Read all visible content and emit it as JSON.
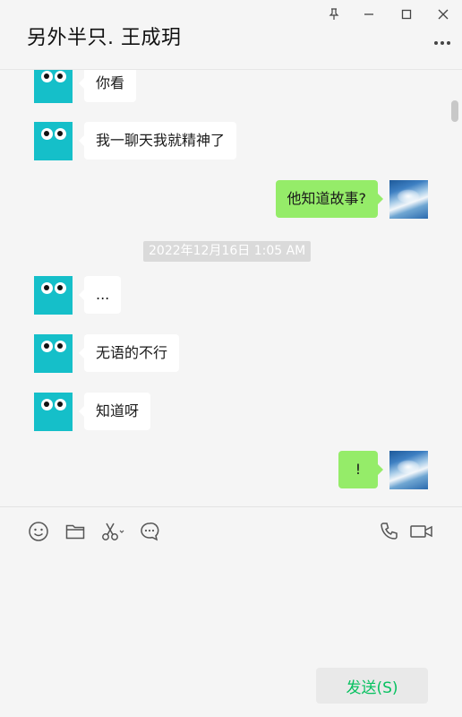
{
  "window": {
    "title": "另外半只. 王成玥",
    "buttons": [
      "pin-icon",
      "minimize-icon",
      "maximize-icon",
      "close-icon"
    ]
  },
  "messages": [
    {
      "side": "in",
      "text": "你看"
    },
    {
      "side": "in",
      "text": "我一聊天我就精神了"
    },
    {
      "side": "out",
      "text": "他知道故事?"
    },
    {
      "side": "in",
      "text": "..."
    },
    {
      "side": "in",
      "text": "无语的不行"
    },
    {
      "side": "in",
      "text": "知道呀"
    },
    {
      "side": "out",
      "text": "!"
    }
  ],
  "timestamp": "2022年12月16日 1:05 AM",
  "toolbar": {
    "left": [
      "emoji-icon",
      "folder-icon",
      "scissors-icon",
      "chat-history-icon"
    ],
    "right": [
      "phone-call-icon",
      "video-call-icon"
    ]
  },
  "input": {
    "value": ""
  },
  "send_label": "发送(S)",
  "colors": {
    "background": "#f5f5f5",
    "bubble_in": "#ffffff",
    "bubble_out": "#95ec69",
    "send_text": "#07c160",
    "avatar_in": "#15bfc9"
  }
}
